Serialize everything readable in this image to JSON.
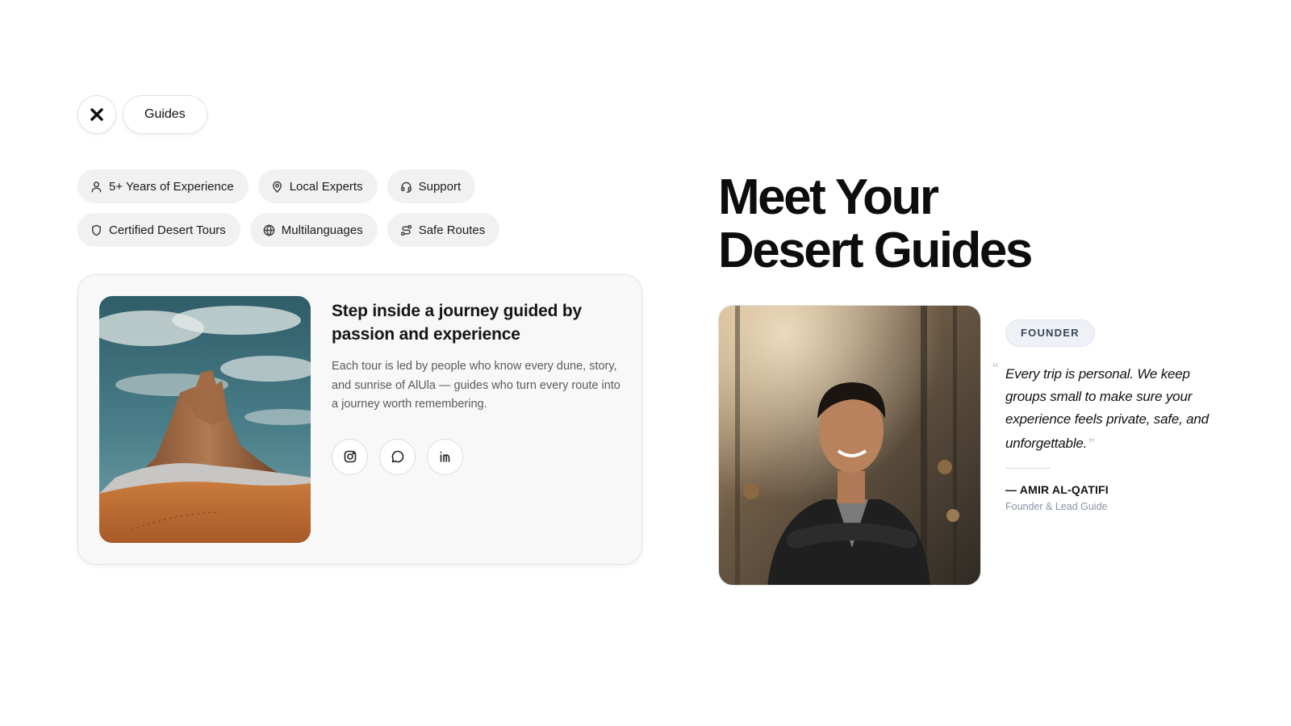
{
  "top": {
    "logo_icon": "close-x-icon",
    "guides_label": "Guides"
  },
  "features": [
    {
      "label": "5+ Years of Experience",
      "icon": "user-icon"
    },
    {
      "label": "Local Experts",
      "icon": "map-pin-icon"
    },
    {
      "label": "Support",
      "icon": "headset-icon"
    },
    {
      "label": "Certified Desert Tours",
      "icon": "shield-icon"
    },
    {
      "label": "Multilanguages",
      "icon": "globe-icon"
    },
    {
      "label": "Safe Routes",
      "icon": "route-icon"
    }
  ],
  "card": {
    "title": "Step inside a journey guided by passion and experience",
    "description": "Each tour is led by people who know every dune, story, and sunrise of AlUla — guides who turn every route into a journey worth remembering.",
    "socials": [
      {
        "icon": "instagram-icon"
      },
      {
        "icon": "chat-bubble-icon"
      },
      {
        "icon": "linkedin-icon"
      }
    ]
  },
  "hero": {
    "heading_line1": "Meet Your",
    "heading_line2": "Desert Guides"
  },
  "founder": {
    "badge": "FOUNDER",
    "quote": "Every trip is personal. We keep groups small to make sure your experience feels private, safe, and unforgettable.",
    "name": "— AMIR AL-QATIFI",
    "role": "Founder & Lead Guide"
  },
  "colors": {
    "chip_bg": "#f1f1f1",
    "card_bg": "#f8f8f8",
    "badge_bg": "#eef1f5",
    "role_text": "#8a93a6"
  }
}
